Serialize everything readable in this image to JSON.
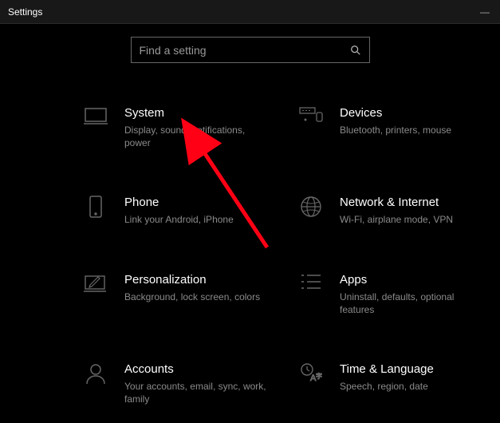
{
  "window": {
    "title": "Settings"
  },
  "search": {
    "placeholder": "Find a setting"
  },
  "cards": {
    "system": {
      "title": "System",
      "desc": "Display, sound, notifications, power"
    },
    "devices": {
      "title": "Devices",
      "desc": "Bluetooth, printers, mouse"
    },
    "phone": {
      "title": "Phone",
      "desc": "Link your Android, iPhone"
    },
    "network": {
      "title": "Network & Internet",
      "desc": "Wi-Fi, airplane mode, VPN"
    },
    "personalization": {
      "title": "Personalization",
      "desc": "Background, lock screen, colors"
    },
    "apps": {
      "title": "Apps",
      "desc": "Uninstall, defaults, optional features"
    },
    "accounts": {
      "title": "Accounts",
      "desc": "Your accounts, email, sync, work, family"
    },
    "time": {
      "title": "Time & Language",
      "desc": "Speech, region, date"
    }
  },
  "annotation": {
    "color": "#ff0015"
  }
}
